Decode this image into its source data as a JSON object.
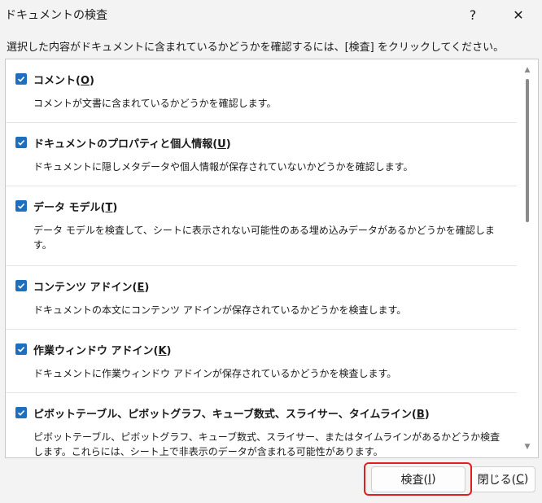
{
  "window": {
    "title": "ドキュメントの検査",
    "help_label": "?",
    "close_label": "✕"
  },
  "instruction": "選択した内容がドキュメントに含まれているかどうかを確認するには、[検査] をクリックしてください。",
  "items": [
    {
      "label": "コメント(",
      "key": "O",
      "label_end": ")",
      "checked": true,
      "description": "コメントが文書に含まれているかどうかを確認します。"
    },
    {
      "label": "ドキュメントのプロパティと個人情報(",
      "key": "U",
      "label_end": ")",
      "checked": true,
      "description": "ドキュメントに隠しメタデータや個人情報が保存されていないかどうかを確認します。"
    },
    {
      "label": "データ モデル(",
      "key": "T",
      "label_end": ")",
      "checked": true,
      "description": "データ モデルを検査して、シートに表示されない可能性のある埋め込みデータがあるかどうかを確認します。"
    },
    {
      "label": "コンテンツ アドイン(",
      "key": "E",
      "label_end": ")",
      "checked": true,
      "description": "ドキュメントの本文にコンテンツ アドインが保存されているかどうかを検査します。"
    },
    {
      "label": "作業ウィンドウ アドイン(",
      "key": "K",
      "label_end": ")",
      "checked": true,
      "description": "ドキュメントに作業ウィンドウ アドインが保存されているかどうかを検査します。"
    },
    {
      "label": "ピボットテーブル、ピボットグラフ、キューブ数式、スライサー、タイムライン(",
      "key": "B",
      "label_end": ")",
      "checked": true,
      "description": "ピボットテーブル、ピボットグラフ、キューブ数式、スライサー、またはタイムラインがあるかどうか検査します。これらには、シート上で非表示のデータが含まれる可能性があります。"
    }
  ],
  "buttons": {
    "inspect_label": "検査(",
    "inspect_key": "I",
    "inspect_end": ")",
    "close_label": "閉じる(",
    "close_key": "C",
    "close_end": ")"
  },
  "colors": {
    "checkbox": "#1f6fbf",
    "highlight": "#e02020"
  },
  "icons": {
    "check": "checkmark-icon",
    "scroll_up": "chevron-up-icon",
    "scroll_down": "chevron-down-icon"
  }
}
